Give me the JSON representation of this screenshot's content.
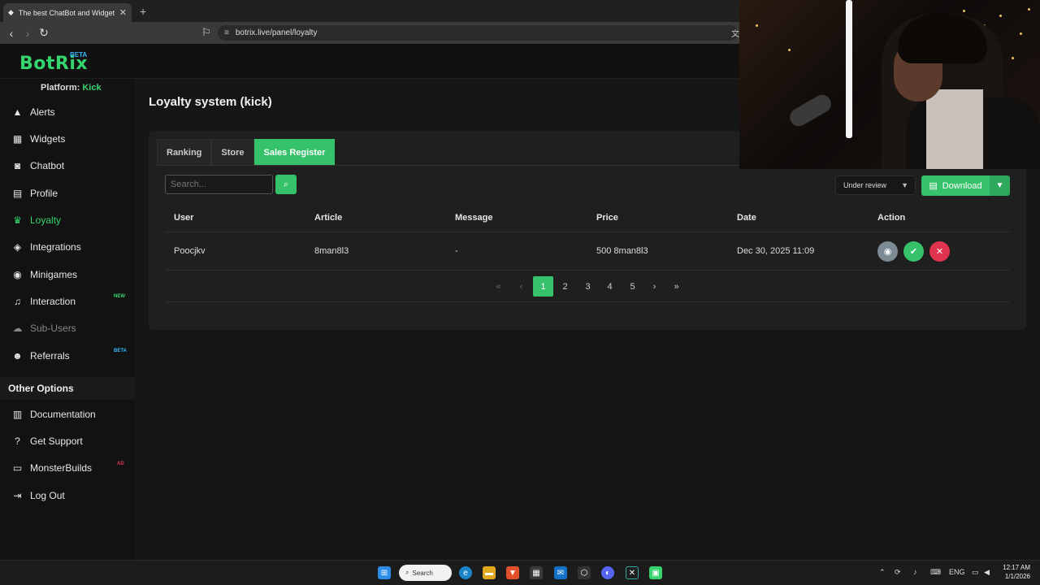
{
  "browser": {
    "tab_title": "The best ChatBot and Widgets f",
    "url": "botrix.live/panel/loyalty"
  },
  "app": {
    "logo": "BotRix",
    "logo_badge": "BETA",
    "platform_label": "Platform:",
    "platform_value": "Kick"
  },
  "sidebar": {
    "items": [
      {
        "label": "Alerts",
        "icon": "warning-icon"
      },
      {
        "label": "Widgets",
        "icon": "grid-icon"
      },
      {
        "label": "Chatbot",
        "icon": "robot-icon"
      },
      {
        "label": "Profile",
        "icon": "id-card-icon"
      },
      {
        "label": "Loyalty",
        "icon": "trophy-icon"
      },
      {
        "label": "Integrations",
        "icon": "puzzle-icon"
      },
      {
        "label": "Minigames",
        "icon": "gamepad-icon"
      },
      {
        "label": "Interaction",
        "icon": "music-icon",
        "badge": "NEW"
      },
      {
        "label": "Sub-Users",
        "icon": "users-icon"
      },
      {
        "label": "Referrals",
        "icon": "user-group-icon",
        "badge": "BETA"
      }
    ],
    "other_heading": "Other Options",
    "other_items": [
      {
        "label": "Documentation",
        "icon": "scroll-icon"
      },
      {
        "label": "Get Support",
        "icon": "question-icon"
      },
      {
        "label": "MonsterBuilds",
        "icon": "laptop-icon",
        "badge": "AD"
      },
      {
        "label": "Log Out",
        "icon": "logout-icon"
      }
    ],
    "accent_color": "#35d56d"
  },
  "main": {
    "title": "Loyalty system (kick)",
    "tabs": [
      "Ranking",
      "Store",
      "Sales Register"
    ],
    "active_tab": "Sales Register",
    "search_placeholder": "Search...",
    "status_filter": "Under review",
    "download_label": "Download",
    "table": {
      "columns": [
        "User",
        "Article",
        "Message",
        "Price",
        "Date",
        "Action"
      ],
      "rows": [
        {
          "user": "Poocjkv",
          "article": "8man8l3",
          "message": "-",
          "price": "500 8man8l3",
          "date": "Dec 30, 2025 11:09"
        }
      ]
    },
    "pagination": {
      "pages": [
        "1",
        "2",
        "3",
        "4",
        "5"
      ],
      "current": "1"
    }
  },
  "taskbar": {
    "search_label": "Search",
    "language": "ENG",
    "time": "12:17 AM",
    "date": "1/1/2026"
  }
}
